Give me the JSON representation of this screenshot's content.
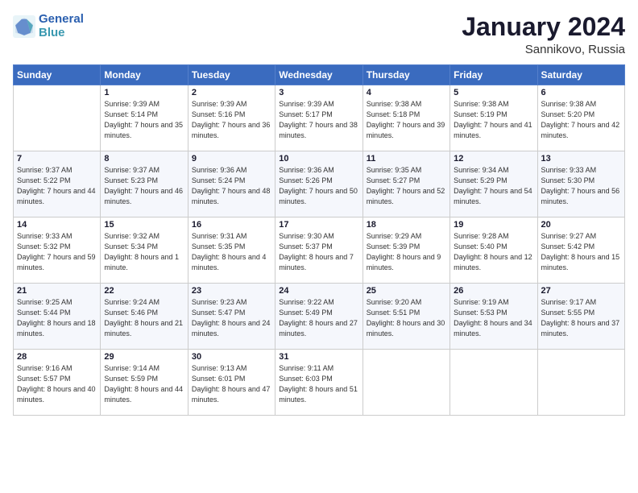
{
  "header": {
    "logo_line1": "General",
    "logo_line2": "Blue",
    "month": "January 2024",
    "location": "Sannikovo, Russia"
  },
  "weekdays": [
    "Sunday",
    "Monday",
    "Tuesday",
    "Wednesday",
    "Thursday",
    "Friday",
    "Saturday"
  ],
  "weeks": [
    [
      {
        "day": "",
        "sunrise": "",
        "sunset": "",
        "daylight": ""
      },
      {
        "day": "1",
        "sunrise": "Sunrise: 9:39 AM",
        "sunset": "Sunset: 5:14 PM",
        "daylight": "Daylight: 7 hours and 35 minutes."
      },
      {
        "day": "2",
        "sunrise": "Sunrise: 9:39 AM",
        "sunset": "Sunset: 5:16 PM",
        "daylight": "Daylight: 7 hours and 36 minutes."
      },
      {
        "day": "3",
        "sunrise": "Sunrise: 9:39 AM",
        "sunset": "Sunset: 5:17 PM",
        "daylight": "Daylight: 7 hours and 38 minutes."
      },
      {
        "day": "4",
        "sunrise": "Sunrise: 9:38 AM",
        "sunset": "Sunset: 5:18 PM",
        "daylight": "Daylight: 7 hours and 39 minutes."
      },
      {
        "day": "5",
        "sunrise": "Sunrise: 9:38 AM",
        "sunset": "Sunset: 5:19 PM",
        "daylight": "Daylight: 7 hours and 41 minutes."
      },
      {
        "day": "6",
        "sunrise": "Sunrise: 9:38 AM",
        "sunset": "Sunset: 5:20 PM",
        "daylight": "Daylight: 7 hours and 42 minutes."
      }
    ],
    [
      {
        "day": "7",
        "sunrise": "Sunrise: 9:37 AM",
        "sunset": "Sunset: 5:22 PM",
        "daylight": "Daylight: 7 hours and 44 minutes."
      },
      {
        "day": "8",
        "sunrise": "Sunrise: 9:37 AM",
        "sunset": "Sunset: 5:23 PM",
        "daylight": "Daylight: 7 hours and 46 minutes."
      },
      {
        "day": "9",
        "sunrise": "Sunrise: 9:36 AM",
        "sunset": "Sunset: 5:24 PM",
        "daylight": "Daylight: 7 hours and 48 minutes."
      },
      {
        "day": "10",
        "sunrise": "Sunrise: 9:36 AM",
        "sunset": "Sunset: 5:26 PM",
        "daylight": "Daylight: 7 hours and 50 minutes."
      },
      {
        "day": "11",
        "sunrise": "Sunrise: 9:35 AM",
        "sunset": "Sunset: 5:27 PM",
        "daylight": "Daylight: 7 hours and 52 minutes."
      },
      {
        "day": "12",
        "sunrise": "Sunrise: 9:34 AM",
        "sunset": "Sunset: 5:29 PM",
        "daylight": "Daylight: 7 hours and 54 minutes."
      },
      {
        "day": "13",
        "sunrise": "Sunrise: 9:33 AM",
        "sunset": "Sunset: 5:30 PM",
        "daylight": "Daylight: 7 hours and 56 minutes."
      }
    ],
    [
      {
        "day": "14",
        "sunrise": "Sunrise: 9:33 AM",
        "sunset": "Sunset: 5:32 PM",
        "daylight": "Daylight: 7 hours and 59 minutes."
      },
      {
        "day": "15",
        "sunrise": "Sunrise: 9:32 AM",
        "sunset": "Sunset: 5:34 PM",
        "daylight": "Daylight: 8 hours and 1 minute."
      },
      {
        "day": "16",
        "sunrise": "Sunrise: 9:31 AM",
        "sunset": "Sunset: 5:35 PM",
        "daylight": "Daylight: 8 hours and 4 minutes."
      },
      {
        "day": "17",
        "sunrise": "Sunrise: 9:30 AM",
        "sunset": "Sunset: 5:37 PM",
        "daylight": "Daylight: 8 hours and 7 minutes."
      },
      {
        "day": "18",
        "sunrise": "Sunrise: 9:29 AM",
        "sunset": "Sunset: 5:39 PM",
        "daylight": "Daylight: 8 hours and 9 minutes."
      },
      {
        "day": "19",
        "sunrise": "Sunrise: 9:28 AM",
        "sunset": "Sunset: 5:40 PM",
        "daylight": "Daylight: 8 hours and 12 minutes."
      },
      {
        "day": "20",
        "sunrise": "Sunrise: 9:27 AM",
        "sunset": "Sunset: 5:42 PM",
        "daylight": "Daylight: 8 hours and 15 minutes."
      }
    ],
    [
      {
        "day": "21",
        "sunrise": "Sunrise: 9:25 AM",
        "sunset": "Sunset: 5:44 PM",
        "daylight": "Daylight: 8 hours and 18 minutes."
      },
      {
        "day": "22",
        "sunrise": "Sunrise: 9:24 AM",
        "sunset": "Sunset: 5:46 PM",
        "daylight": "Daylight: 8 hours and 21 minutes."
      },
      {
        "day": "23",
        "sunrise": "Sunrise: 9:23 AM",
        "sunset": "Sunset: 5:47 PM",
        "daylight": "Daylight: 8 hours and 24 minutes."
      },
      {
        "day": "24",
        "sunrise": "Sunrise: 9:22 AM",
        "sunset": "Sunset: 5:49 PM",
        "daylight": "Daylight: 8 hours and 27 minutes."
      },
      {
        "day": "25",
        "sunrise": "Sunrise: 9:20 AM",
        "sunset": "Sunset: 5:51 PM",
        "daylight": "Daylight: 8 hours and 30 minutes."
      },
      {
        "day": "26",
        "sunrise": "Sunrise: 9:19 AM",
        "sunset": "Sunset: 5:53 PM",
        "daylight": "Daylight: 8 hours and 34 minutes."
      },
      {
        "day": "27",
        "sunrise": "Sunrise: 9:17 AM",
        "sunset": "Sunset: 5:55 PM",
        "daylight": "Daylight: 8 hours and 37 minutes."
      }
    ],
    [
      {
        "day": "28",
        "sunrise": "Sunrise: 9:16 AM",
        "sunset": "Sunset: 5:57 PM",
        "daylight": "Daylight: 8 hours and 40 minutes."
      },
      {
        "day": "29",
        "sunrise": "Sunrise: 9:14 AM",
        "sunset": "Sunset: 5:59 PM",
        "daylight": "Daylight: 8 hours and 44 minutes."
      },
      {
        "day": "30",
        "sunrise": "Sunrise: 9:13 AM",
        "sunset": "Sunset: 6:01 PM",
        "daylight": "Daylight: 8 hours and 47 minutes."
      },
      {
        "day": "31",
        "sunrise": "Sunrise: 9:11 AM",
        "sunset": "Sunset: 6:03 PM",
        "daylight": "Daylight: 8 hours and 51 minutes."
      },
      {
        "day": "",
        "sunrise": "",
        "sunset": "",
        "daylight": ""
      },
      {
        "day": "",
        "sunrise": "",
        "sunset": "",
        "daylight": ""
      },
      {
        "day": "",
        "sunrise": "",
        "sunset": "",
        "daylight": ""
      }
    ]
  ]
}
